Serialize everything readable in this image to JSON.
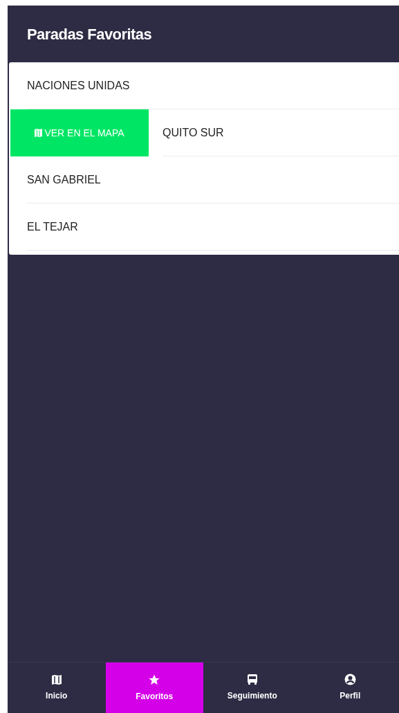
{
  "header": {
    "title": "Paradas Favoritas"
  },
  "stops": [
    {
      "name": "NACIONES UNIDAS",
      "swiped": false
    },
    {
      "name": "QUITO SUR",
      "swiped": true,
      "action": "VER EN EL MAPA"
    },
    {
      "name": "SAN GABRIEL",
      "swiped": false
    },
    {
      "name": "EL TEJAR",
      "swiped": false
    }
  ],
  "tabs": [
    {
      "label": "Inicio",
      "selected": false
    },
    {
      "label": "Favoritos",
      "selected": true
    },
    {
      "label": "Seguimiento",
      "selected": false
    },
    {
      "label": "Perfil",
      "selected": false
    }
  ]
}
